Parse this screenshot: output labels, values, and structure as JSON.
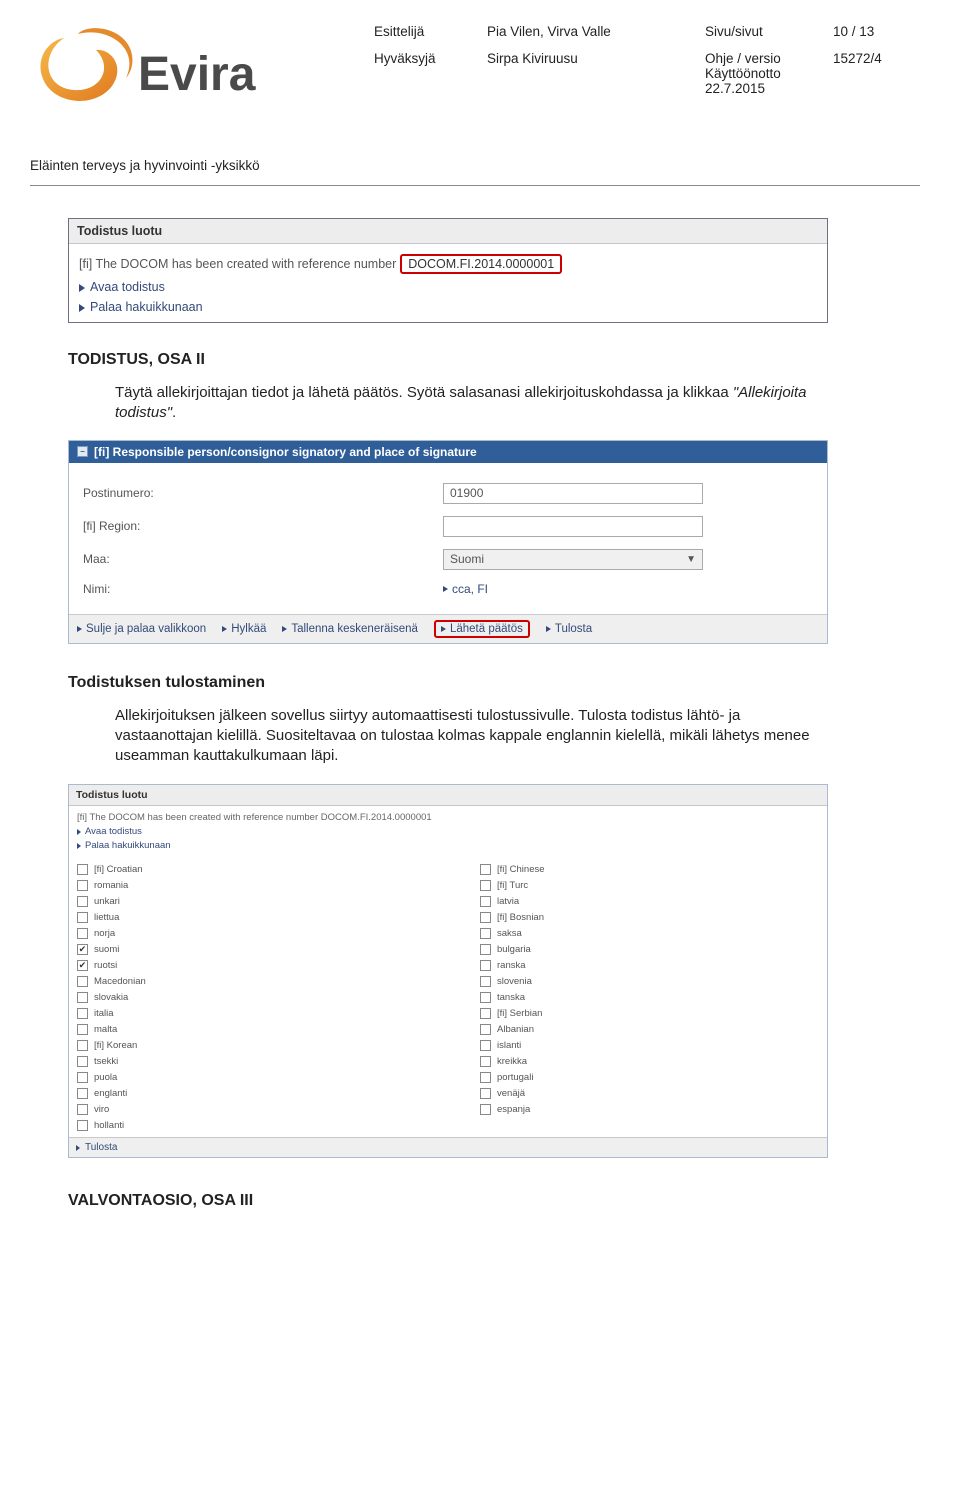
{
  "header": {
    "logo_text": "Evira",
    "meta": {
      "r1c1": "Esittelijä",
      "r1c2": "Pia Vilen, Virva Valle",
      "r1c3": "Sivu/sivut",
      "r1c4": "10 / 13",
      "r2c1": "Hyväksyjä",
      "r2c2": "Sirpa Kiviruusu",
      "r2c3_l1": "Ohje / versio",
      "r2c3_l2": "Käyttöönotto",
      "r2c3_l3": "22.7.2015",
      "r2c4": "15272/4"
    },
    "unit": "Eläinten terveys ja hyvinvointi -yksikkö"
  },
  "box1": {
    "title": "Todistus luotu",
    "ref_prefix": "[fi] The DOCOM has been created with reference number",
    "ref_value": "DOCOM.FI.2014.0000001",
    "link_open": "Avaa todistus",
    "link_back": "Palaa hakuikkunaan"
  },
  "section1": {
    "heading": "TODISTUS, OSA II",
    "p1a": "Täytä allekirjoittajan tiedot ja lähetä päätös. Syötä salasanasi allekirjoituskohdassa ja klikkaa ",
    "p1b_it": "\"Allekirjoita todistus\"",
    "p1c": "."
  },
  "box2": {
    "sig_title": "[fi] Responsible person/consignor signatory and place of signature",
    "mini_box_glyph": "−",
    "labels": {
      "postal": "Postinumero:",
      "region": "[fi] Region:",
      "country": "Maa:",
      "name": "Nimi:"
    },
    "values": {
      "postal": "01900",
      "region": "",
      "country": "Suomi",
      "name": "cca, FI"
    },
    "actions": {
      "close": "Sulje ja palaa valikkoon",
      "reject": "Hylkää",
      "save_draft": "Tallenna keskeneräisenä",
      "send": "Lähetä päätös",
      "print": "Tulosta"
    }
  },
  "section2": {
    "heading": "Todistuksen tulostaminen",
    "p1": "Allekirjoituksen jälkeen sovellus siirtyy automaattisesti tulostussivulle. Tulosta todistus lähtö- ja vastaanottajan kielillä. Suositeltavaa on tulostaa kolmas kappale englannin kielellä, mikäli lähetys menee useamman kauttakulkumaan läpi."
  },
  "box3": {
    "title": "Todistus luotu",
    "ref_line": "[fi] The DOCOM has been created with reference number DOCOM.FI.2014.0000001",
    "link_open": "Avaa todistus",
    "link_back": "Palaa hakuikkunaan",
    "langs_left": [
      {
        "label": "[fi] Croatian",
        "checked": false
      },
      {
        "label": "romania",
        "checked": false
      },
      {
        "label": "unkari",
        "checked": false
      },
      {
        "label": "liettua",
        "checked": false
      },
      {
        "label": "norja",
        "checked": false
      },
      {
        "label": "suomi",
        "checked": true
      },
      {
        "label": "ruotsi",
        "checked": true
      },
      {
        "label": "Macedonian",
        "checked": false
      },
      {
        "label": "slovakia",
        "checked": false
      },
      {
        "label": "italia",
        "checked": false
      },
      {
        "label": "malta",
        "checked": false
      },
      {
        "label": "[fi] Korean",
        "checked": false
      },
      {
        "label": "tsekki",
        "checked": false
      },
      {
        "label": "puola",
        "checked": false
      },
      {
        "label": "englanti",
        "checked": false
      },
      {
        "label": "viro",
        "checked": false
      },
      {
        "label": "hollanti",
        "checked": false
      }
    ],
    "langs_right": [
      {
        "label": "[fi] Chinese",
        "checked": false
      },
      {
        "label": "[fi] Turc",
        "checked": false
      },
      {
        "label": "latvia",
        "checked": false
      },
      {
        "label": "[fi] Bosnian",
        "checked": false
      },
      {
        "label": "saksa",
        "checked": false
      },
      {
        "label": "bulgaria",
        "checked": false
      },
      {
        "label": "ranska",
        "checked": false
      },
      {
        "label": "slovenia",
        "checked": false
      },
      {
        "label": "tanska",
        "checked": false
      },
      {
        "label": "[fi] Serbian",
        "checked": false
      },
      {
        "label": "Albanian",
        "checked": false
      },
      {
        "label": "islanti",
        "checked": false
      },
      {
        "label": "kreikka",
        "checked": false
      },
      {
        "label": "portugali",
        "checked": false
      },
      {
        "label": "venäjä",
        "checked": false
      },
      {
        "label": "espanja",
        "checked": false
      }
    ],
    "print": "Tulosta"
  },
  "final_heading": "VALVONTAOSIO, OSA III"
}
